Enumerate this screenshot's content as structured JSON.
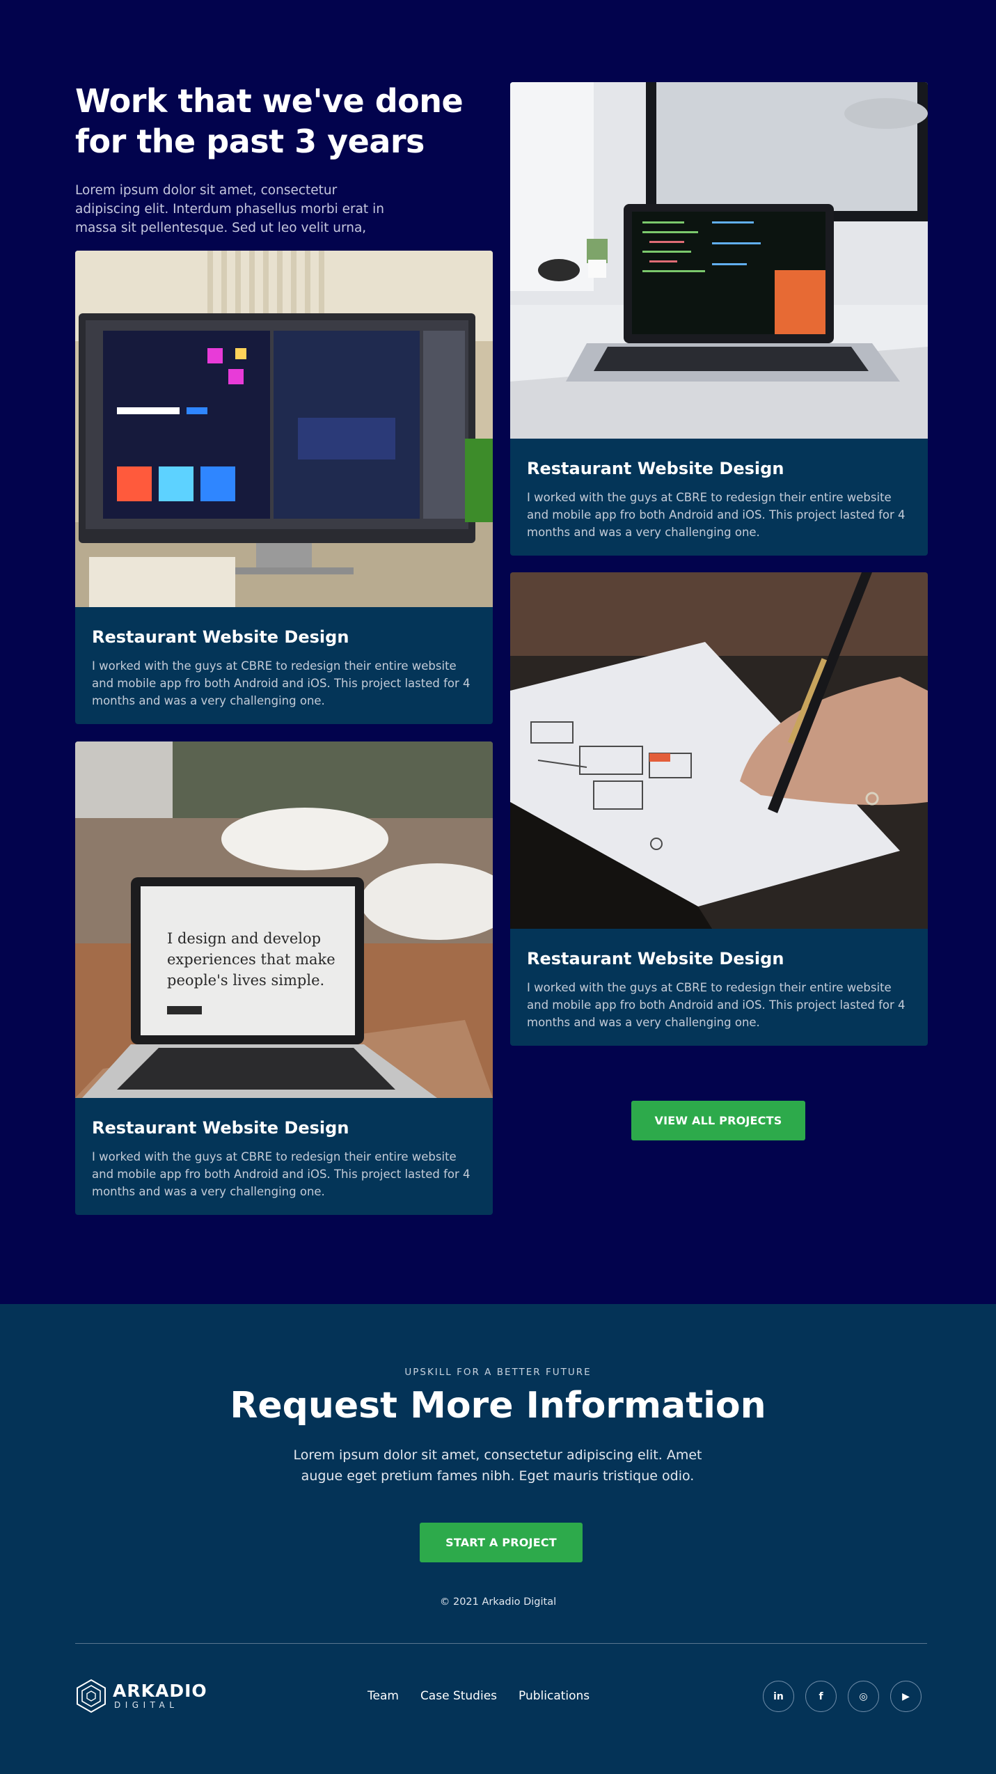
{
  "intro": {
    "title_line1": "Work that we've done",
    "title_line2": "for the past 3 years",
    "text": "Lorem ipsum dolor sit amet, consectetur adipiscing elit. Interdum phasellus morbi erat in massa sit pellentesque. Sed ut leo velit urna,"
  },
  "cards": [
    {
      "title": "Restaurant Website Design",
      "text": "I worked with the guys at CBRE to redesign their entire website and mobile app fro both Android and iOS. This project lasted for 4 months and was a very challenging one."
    },
    {
      "title": "Restaurant Website Design",
      "text": "I worked with the guys at CBRE to redesign their entire website and mobile app fro both Android and iOS. This project lasted for 4 months and was a very challenging one."
    },
    {
      "title": "Restaurant Website Design",
      "text": "I worked with the guys at CBRE to redesign their entire website and mobile app fro both Android and iOS. This project lasted for 4 months and was a very challenging one.",
      "screen_text": [
        "I design and develop",
        "experiences that make",
        "people's lives simple."
      ]
    },
    {
      "title": "Restaurant Website Design",
      "text": "I worked with the guys at CBRE to redesign their entire website and mobile app fro both Android and iOS. This project lasted for 4 months and was a very challenging one."
    }
  ],
  "view_all_label": "VIEW ALL PROJECTS",
  "cta": {
    "eyebrow": "UPSKILL FOR A BETTER FUTURE",
    "title": "Request More Information",
    "text": "Lorem ipsum dolor sit amet, consectetur adipiscing elit. Amet augue eget pretium fames nibh. Eget mauris tristique odio.",
    "button": "START A PROJECT",
    "copyright": "© 2021 Arkadio Digital"
  },
  "footer": {
    "logo_name": "ARKADIO",
    "logo_sub": "DIGITAL",
    "nav": [
      "Team",
      "Case Studies",
      "Publications"
    ],
    "social": [
      {
        "icon": "linkedin-icon",
        "glyph": "in"
      },
      {
        "icon": "facebook-icon",
        "glyph": "f"
      },
      {
        "icon": "instagram-icon",
        "glyph": "◎"
      },
      {
        "icon": "youtube-icon",
        "glyph": "▶"
      }
    ]
  },
  "colors": {
    "page_bg": "#02034d",
    "card_bg": "#043558",
    "cta_bg": "#043357",
    "accent_green": "#2daa4b"
  }
}
